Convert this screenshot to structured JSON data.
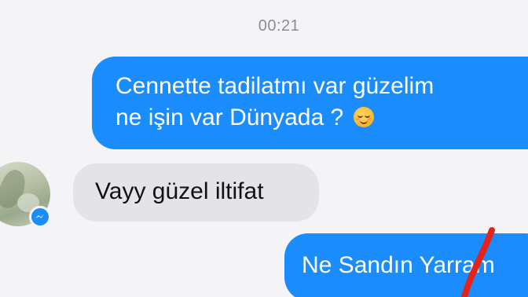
{
  "conversation": {
    "timestamp": "00:21",
    "messages": [
      {
        "direction": "outgoing",
        "lines": [
          "Cennette tadilatmı var güzelim",
          "ne işin var Dünyada ?"
        ],
        "emoji": "smiling-face-with-smiling-eyes"
      },
      {
        "direction": "incoming",
        "text": "Vayy güzel iltifat"
      },
      {
        "direction": "outgoing",
        "text": "Ne Sandın Yarram"
      }
    ]
  },
  "contact": {
    "avatar_icon": "contact-avatar",
    "badge_icon": "messenger-icon"
  },
  "colors": {
    "background": "#f4f4f6",
    "outgoing_bubble": "#1a8cfc",
    "incoming_bubble": "#e4e4e8",
    "timestamp_text": "#8c8c93",
    "annotation_mark": "#e5231b"
  }
}
